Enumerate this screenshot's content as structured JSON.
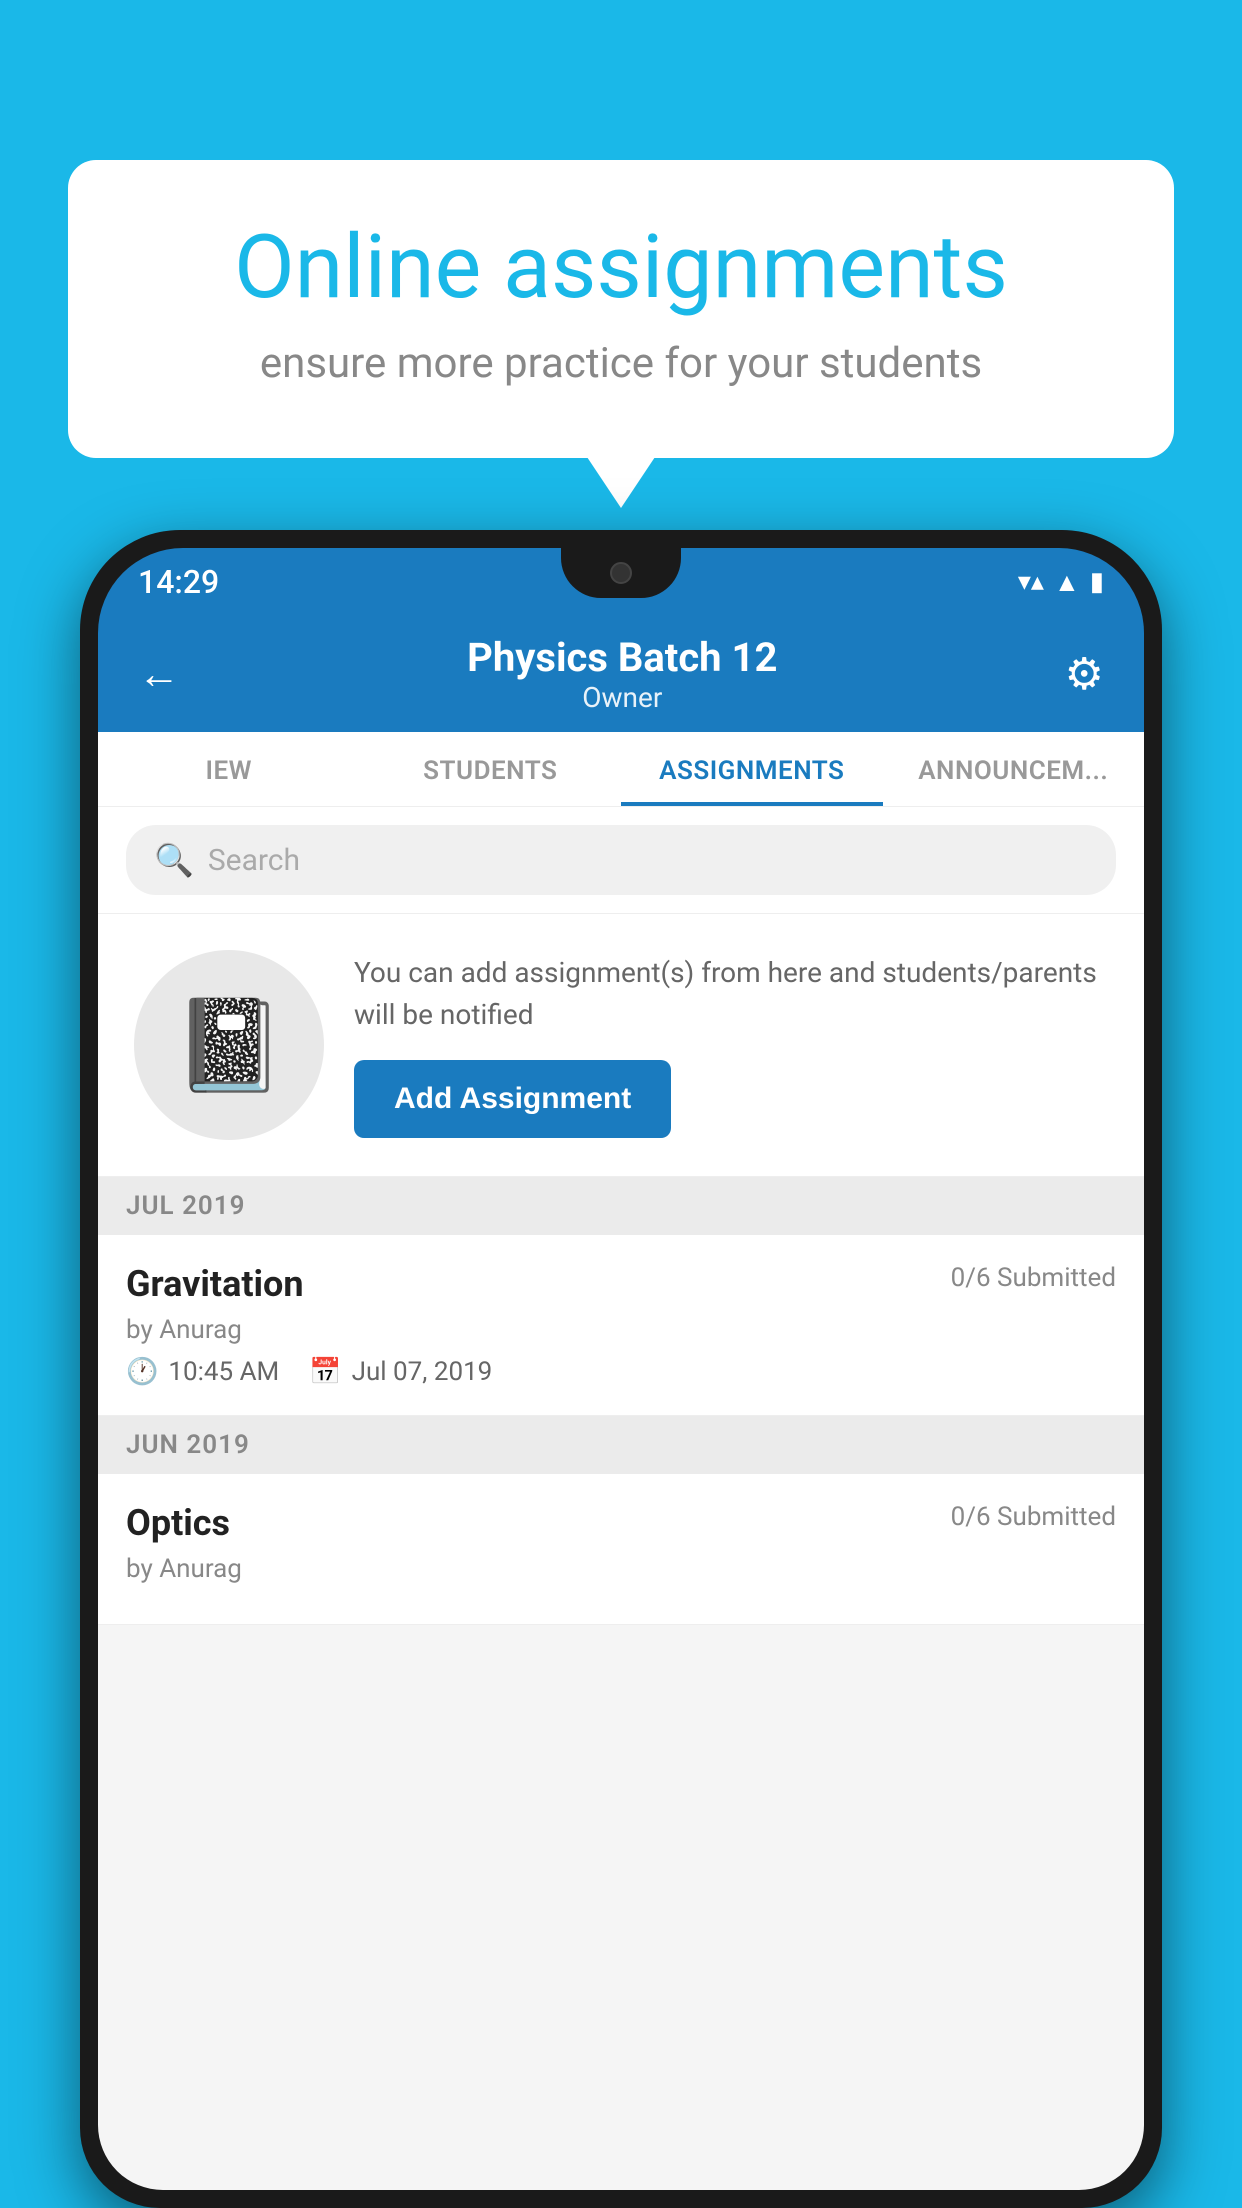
{
  "background_color": "#1ab8e8",
  "speech_bubble": {
    "title": "Online assignments",
    "subtitle": "ensure more practice for your students"
  },
  "phone": {
    "status_bar": {
      "time": "14:29",
      "icons": [
        "wifi",
        "signal",
        "battery"
      ]
    },
    "header": {
      "title": "Physics Batch 12",
      "subtitle": "Owner",
      "back_label": "←",
      "settings_label": "⚙"
    },
    "tabs": [
      {
        "label": "IEW",
        "active": false
      },
      {
        "label": "STUDENTS",
        "active": false
      },
      {
        "label": "ASSIGNMENTS",
        "active": true
      },
      {
        "label": "ANNOUNCEM...",
        "active": false
      }
    ],
    "search": {
      "placeholder": "Search"
    },
    "assignment_prompt": {
      "description": "You can add assignment(s) from here and students/parents will be notified",
      "button_label": "Add Assignment"
    },
    "months": [
      {
        "label": "JUL 2019",
        "assignments": [
          {
            "name": "Gravitation",
            "submitted": "0/6 Submitted",
            "author": "by Anurag",
            "time": "10:45 AM",
            "date": "Jul 07, 2019"
          }
        ]
      },
      {
        "label": "JUN 2019",
        "assignments": [
          {
            "name": "Optics",
            "submitted": "0/6 Submitted",
            "author": "by Anurag",
            "time": "",
            "date": ""
          }
        ]
      }
    ]
  }
}
